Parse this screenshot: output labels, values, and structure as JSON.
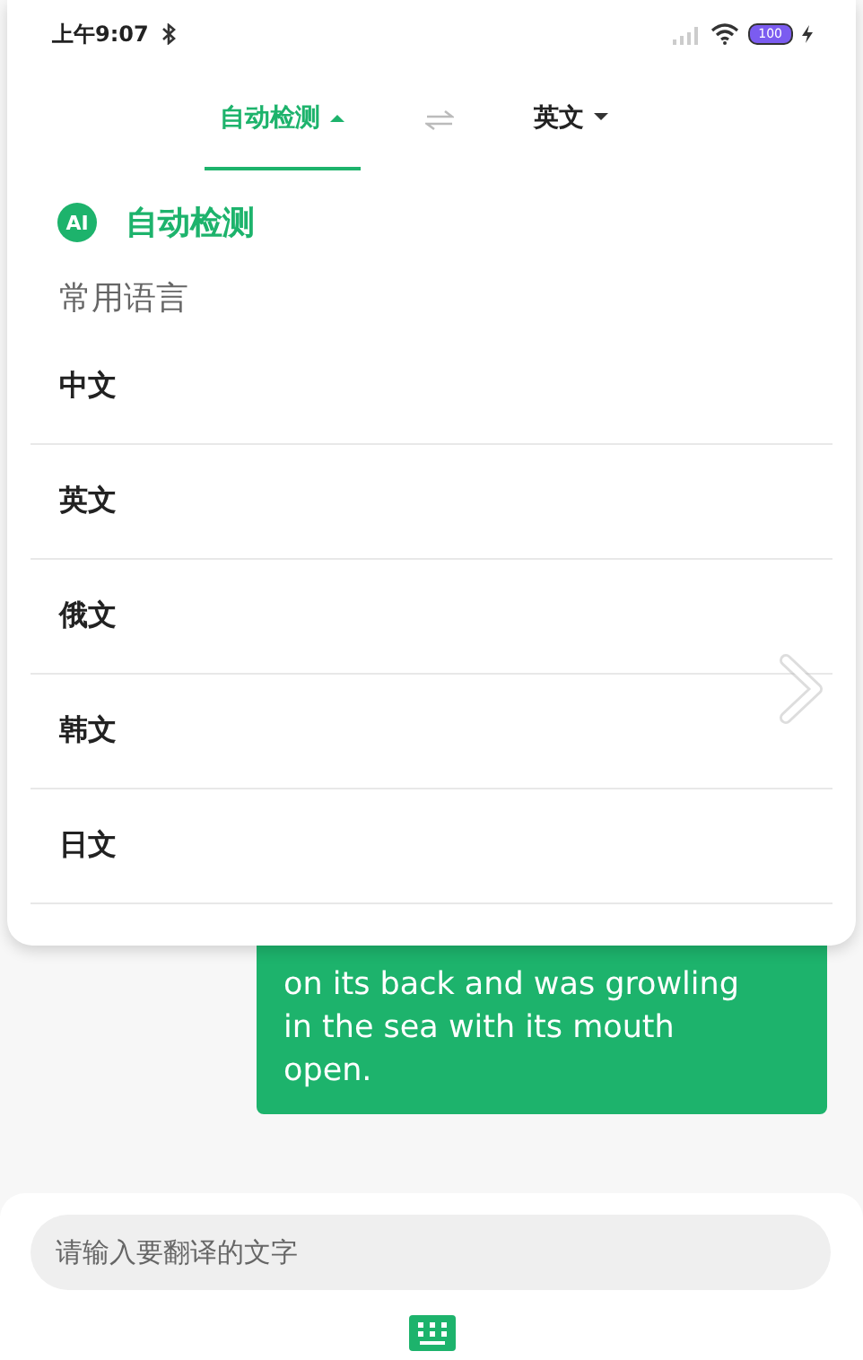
{
  "status_bar": {
    "time": "上午9:07",
    "battery": "100"
  },
  "language_tabs": [
    {
      "label": "自动检测",
      "selected": true,
      "expanded": true
    },
    {
      "label": "英文",
      "selected": false,
      "expanded": false
    }
  ],
  "auto_detect": {
    "badge": "AI",
    "label": "自动检测"
  },
  "section_title": "常用语言",
  "languages": [
    "中文",
    "英文",
    "俄文",
    "韩文",
    "日文"
  ],
  "message": {
    "text": "on its back and was growling in the sea with its mouth open."
  },
  "input": {
    "placeholder": "请输入要翻译的文字"
  }
}
